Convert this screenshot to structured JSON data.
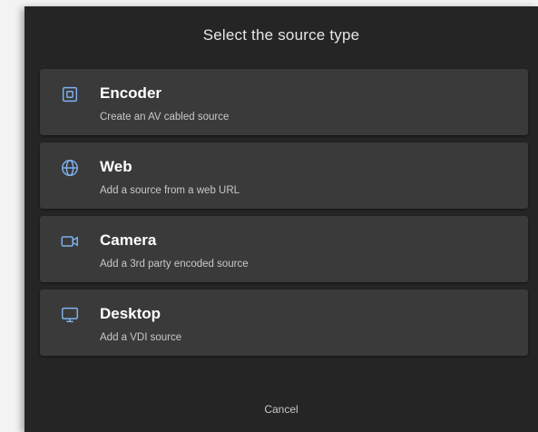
{
  "dialog": {
    "title": "Select the source type",
    "cancel_label": "Cancel"
  },
  "options": [
    {
      "label": "Encoder",
      "description": "Create an AV cabled source",
      "icon": "encoder-icon"
    },
    {
      "label": "Web",
      "description": "Add a source from a web URL",
      "icon": "globe-icon"
    },
    {
      "label": "Camera",
      "description": "Add a 3rd party encoded source",
      "icon": "video-camera-icon"
    },
    {
      "label": "Desktop",
      "description": "Add a VDI source",
      "icon": "monitor-icon"
    }
  ],
  "colors": {
    "dialog_bg": "#252525",
    "card_bg": "#3a3a3a",
    "icon_accent": "#7fb0ee",
    "title_text": "#e6e6e6",
    "label_text": "#ffffff",
    "desc_text": "#c9c9c9"
  }
}
